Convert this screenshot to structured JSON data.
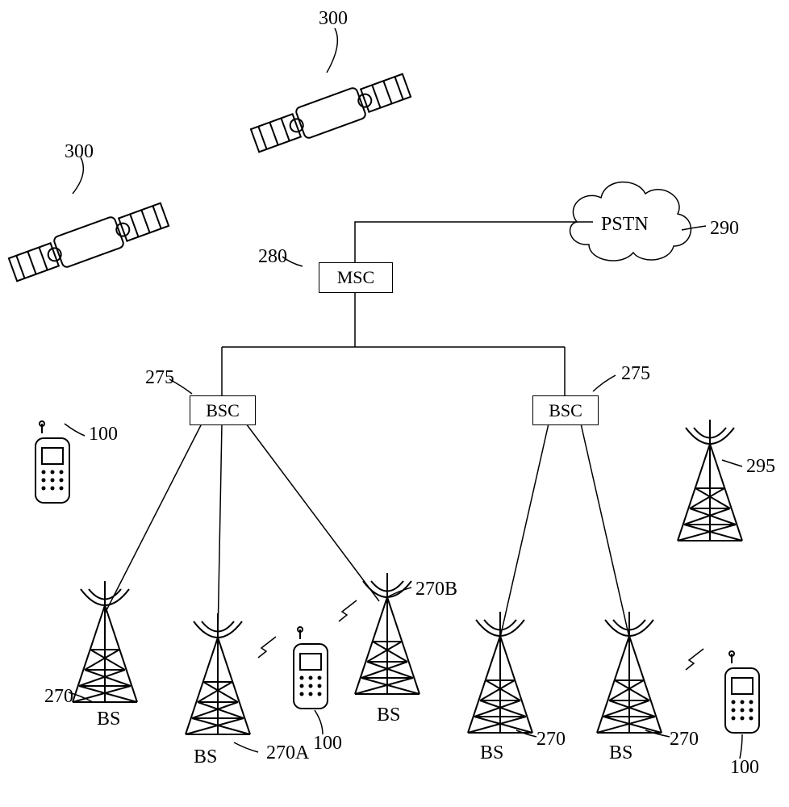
{
  "labels": {
    "sat1": "300",
    "sat2": "300",
    "pstn": "PSTN",
    "pstn_no": "290",
    "msc": "MSC",
    "msc_no": "280",
    "bsc_left": "BSC",
    "bsc_right": "BSC",
    "bsc_no_left": "275",
    "bsc_no_right": "275",
    "phone_no": "100",
    "tower_no_295": "295",
    "bs": "BS",
    "tower_no_270": "270",
    "tower_no_270A": "270A",
    "tower_no_270B": "270B"
  }
}
